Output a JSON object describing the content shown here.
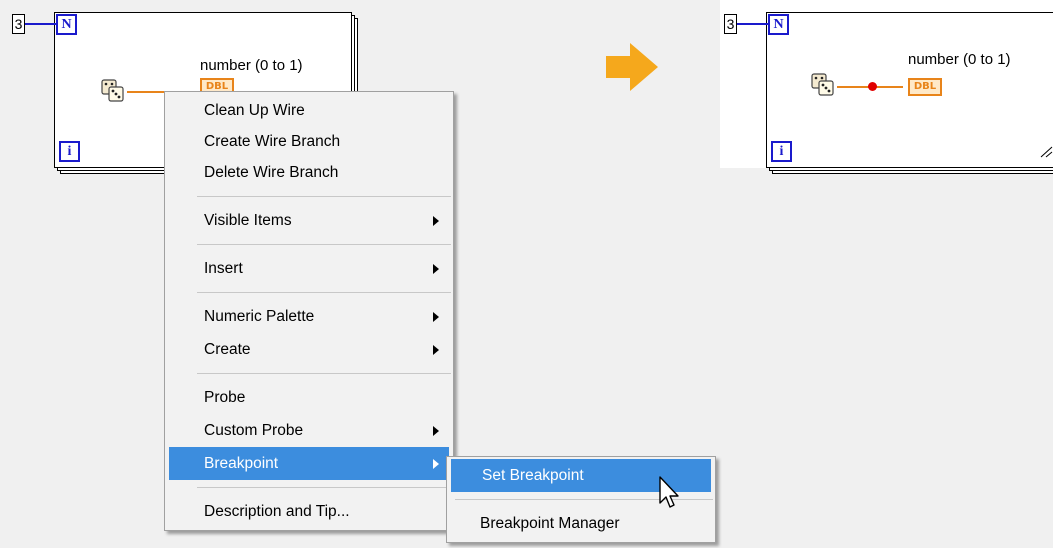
{
  "left_diagram": {
    "count_value": "3",
    "n_terminal": "N",
    "i_terminal": "i",
    "indicator_label": "number (0 to 1)",
    "indicator_type": "DBL",
    "icon": "random-number-dice-icon"
  },
  "transition_icon": "right-arrow-icon",
  "right_diagram": {
    "count_value": "3",
    "n_terminal": "N",
    "i_terminal": "i",
    "indicator_label": "number (0 to 1)",
    "indicator_type": "DBL",
    "icon": "random-number-dice-icon",
    "breakpoint_color": "#e00000"
  },
  "context_menu": {
    "items": [
      {
        "label": "Clean Up Wire"
      },
      {
        "label": "Create Wire Branch"
      },
      {
        "label": "Delete Wire Branch"
      },
      {
        "label": "Visible Items"
      },
      {
        "label": "Insert"
      },
      {
        "label": "Numeric Palette"
      },
      {
        "label": "Create"
      },
      {
        "label": "Probe"
      },
      {
        "label": "Custom Probe"
      },
      {
        "label": "Breakpoint"
      },
      {
        "label": "Description and Tip..."
      }
    ]
  },
  "submenu": {
    "items": [
      {
        "label": "Set Breakpoint"
      },
      {
        "label": "Breakpoint Manager"
      }
    ]
  },
  "colors": {
    "highlight": "#3c8dde",
    "arrow": "#f5a81c",
    "wire_numeric": "#e8841a",
    "terminal_blue": "#1a1acc"
  }
}
